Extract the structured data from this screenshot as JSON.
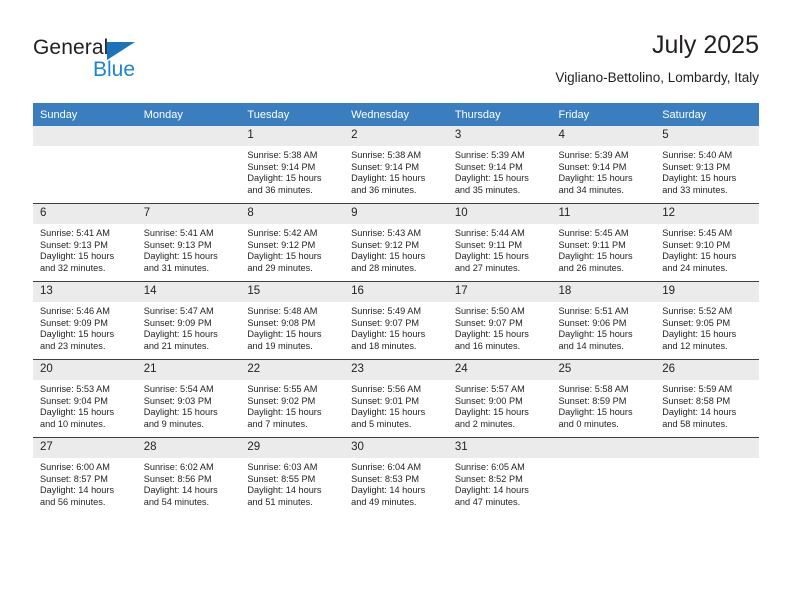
{
  "brand": {
    "name_top": "General",
    "name_bottom": "Blue",
    "triangle_color": "#1c72bb",
    "blue_color": "#1c85d4"
  },
  "header": {
    "title": "July 2025",
    "subtitle": "Vigliano-Bettolino, Lombardy, Italy"
  },
  "theme": {
    "header_bg": "#3a7ec0",
    "header_text": "#ffffff",
    "daynum_bg": "#ebebeb",
    "row_line": "#3f3f3f",
    "text": "#231f20"
  },
  "weekdays": [
    "Sunday",
    "Monday",
    "Tuesday",
    "Wednesday",
    "Thursday",
    "Friday",
    "Saturday"
  ],
  "weeks": [
    [
      {
        "day": "",
        "sunrise": "",
        "sunset": "",
        "daylight_1": "",
        "daylight_2": ""
      },
      {
        "day": "",
        "sunrise": "",
        "sunset": "",
        "daylight_1": "",
        "daylight_2": ""
      },
      {
        "day": "1",
        "sunrise": "Sunrise: 5:38 AM",
        "sunset": "Sunset: 9:14 PM",
        "daylight_1": "Daylight: 15 hours",
        "daylight_2": "and 36 minutes."
      },
      {
        "day": "2",
        "sunrise": "Sunrise: 5:38 AM",
        "sunset": "Sunset: 9:14 PM",
        "daylight_1": "Daylight: 15 hours",
        "daylight_2": "and 36 minutes."
      },
      {
        "day": "3",
        "sunrise": "Sunrise: 5:39 AM",
        "sunset": "Sunset: 9:14 PM",
        "daylight_1": "Daylight: 15 hours",
        "daylight_2": "and 35 minutes."
      },
      {
        "day": "4",
        "sunrise": "Sunrise: 5:39 AM",
        "sunset": "Sunset: 9:14 PM",
        "daylight_1": "Daylight: 15 hours",
        "daylight_2": "and 34 minutes."
      },
      {
        "day": "5",
        "sunrise": "Sunrise: 5:40 AM",
        "sunset": "Sunset: 9:13 PM",
        "daylight_1": "Daylight: 15 hours",
        "daylight_2": "and 33 minutes."
      }
    ],
    [
      {
        "day": "6",
        "sunrise": "Sunrise: 5:41 AM",
        "sunset": "Sunset: 9:13 PM",
        "daylight_1": "Daylight: 15 hours",
        "daylight_2": "and 32 minutes."
      },
      {
        "day": "7",
        "sunrise": "Sunrise: 5:41 AM",
        "sunset": "Sunset: 9:13 PM",
        "daylight_1": "Daylight: 15 hours",
        "daylight_2": "and 31 minutes."
      },
      {
        "day": "8",
        "sunrise": "Sunrise: 5:42 AM",
        "sunset": "Sunset: 9:12 PM",
        "daylight_1": "Daylight: 15 hours",
        "daylight_2": "and 29 minutes."
      },
      {
        "day": "9",
        "sunrise": "Sunrise: 5:43 AM",
        "sunset": "Sunset: 9:12 PM",
        "daylight_1": "Daylight: 15 hours",
        "daylight_2": "and 28 minutes."
      },
      {
        "day": "10",
        "sunrise": "Sunrise: 5:44 AM",
        "sunset": "Sunset: 9:11 PM",
        "daylight_1": "Daylight: 15 hours",
        "daylight_2": "and 27 minutes."
      },
      {
        "day": "11",
        "sunrise": "Sunrise: 5:45 AM",
        "sunset": "Sunset: 9:11 PM",
        "daylight_1": "Daylight: 15 hours",
        "daylight_2": "and 26 minutes."
      },
      {
        "day": "12",
        "sunrise": "Sunrise: 5:45 AM",
        "sunset": "Sunset: 9:10 PM",
        "daylight_1": "Daylight: 15 hours",
        "daylight_2": "and 24 minutes."
      }
    ],
    [
      {
        "day": "13",
        "sunrise": "Sunrise: 5:46 AM",
        "sunset": "Sunset: 9:09 PM",
        "daylight_1": "Daylight: 15 hours",
        "daylight_2": "and 23 minutes."
      },
      {
        "day": "14",
        "sunrise": "Sunrise: 5:47 AM",
        "sunset": "Sunset: 9:09 PM",
        "daylight_1": "Daylight: 15 hours",
        "daylight_2": "and 21 minutes."
      },
      {
        "day": "15",
        "sunrise": "Sunrise: 5:48 AM",
        "sunset": "Sunset: 9:08 PM",
        "daylight_1": "Daylight: 15 hours",
        "daylight_2": "and 19 minutes."
      },
      {
        "day": "16",
        "sunrise": "Sunrise: 5:49 AM",
        "sunset": "Sunset: 9:07 PM",
        "daylight_1": "Daylight: 15 hours",
        "daylight_2": "and 18 minutes."
      },
      {
        "day": "17",
        "sunrise": "Sunrise: 5:50 AM",
        "sunset": "Sunset: 9:07 PM",
        "daylight_1": "Daylight: 15 hours",
        "daylight_2": "and 16 minutes."
      },
      {
        "day": "18",
        "sunrise": "Sunrise: 5:51 AM",
        "sunset": "Sunset: 9:06 PM",
        "daylight_1": "Daylight: 15 hours",
        "daylight_2": "and 14 minutes."
      },
      {
        "day": "19",
        "sunrise": "Sunrise: 5:52 AM",
        "sunset": "Sunset: 9:05 PM",
        "daylight_1": "Daylight: 15 hours",
        "daylight_2": "and 12 minutes."
      }
    ],
    [
      {
        "day": "20",
        "sunrise": "Sunrise: 5:53 AM",
        "sunset": "Sunset: 9:04 PM",
        "daylight_1": "Daylight: 15 hours",
        "daylight_2": "and 10 minutes."
      },
      {
        "day": "21",
        "sunrise": "Sunrise: 5:54 AM",
        "sunset": "Sunset: 9:03 PM",
        "daylight_1": "Daylight: 15 hours",
        "daylight_2": "and 9 minutes."
      },
      {
        "day": "22",
        "sunrise": "Sunrise: 5:55 AM",
        "sunset": "Sunset: 9:02 PM",
        "daylight_1": "Daylight: 15 hours",
        "daylight_2": "and 7 minutes."
      },
      {
        "day": "23",
        "sunrise": "Sunrise: 5:56 AM",
        "sunset": "Sunset: 9:01 PM",
        "daylight_1": "Daylight: 15 hours",
        "daylight_2": "and 5 minutes."
      },
      {
        "day": "24",
        "sunrise": "Sunrise: 5:57 AM",
        "sunset": "Sunset: 9:00 PM",
        "daylight_1": "Daylight: 15 hours",
        "daylight_2": "and 2 minutes."
      },
      {
        "day": "25",
        "sunrise": "Sunrise: 5:58 AM",
        "sunset": "Sunset: 8:59 PM",
        "daylight_1": "Daylight: 15 hours",
        "daylight_2": "and 0 minutes."
      },
      {
        "day": "26",
        "sunrise": "Sunrise: 5:59 AM",
        "sunset": "Sunset: 8:58 PM",
        "daylight_1": "Daylight: 14 hours",
        "daylight_2": "and 58 minutes."
      }
    ],
    [
      {
        "day": "27",
        "sunrise": "Sunrise: 6:00 AM",
        "sunset": "Sunset: 8:57 PM",
        "daylight_1": "Daylight: 14 hours",
        "daylight_2": "and 56 minutes."
      },
      {
        "day": "28",
        "sunrise": "Sunrise: 6:02 AM",
        "sunset": "Sunset: 8:56 PM",
        "daylight_1": "Daylight: 14 hours",
        "daylight_2": "and 54 minutes."
      },
      {
        "day": "29",
        "sunrise": "Sunrise: 6:03 AM",
        "sunset": "Sunset: 8:55 PM",
        "daylight_1": "Daylight: 14 hours",
        "daylight_2": "and 51 minutes."
      },
      {
        "day": "30",
        "sunrise": "Sunrise: 6:04 AM",
        "sunset": "Sunset: 8:53 PM",
        "daylight_1": "Daylight: 14 hours",
        "daylight_2": "and 49 minutes."
      },
      {
        "day": "31",
        "sunrise": "Sunrise: 6:05 AM",
        "sunset": "Sunset: 8:52 PM",
        "daylight_1": "Daylight: 14 hours",
        "daylight_2": "and 47 minutes."
      },
      {
        "day": "",
        "sunrise": "",
        "sunset": "",
        "daylight_1": "",
        "daylight_2": ""
      },
      {
        "day": "",
        "sunrise": "",
        "sunset": "",
        "daylight_1": "",
        "daylight_2": ""
      }
    ]
  ]
}
